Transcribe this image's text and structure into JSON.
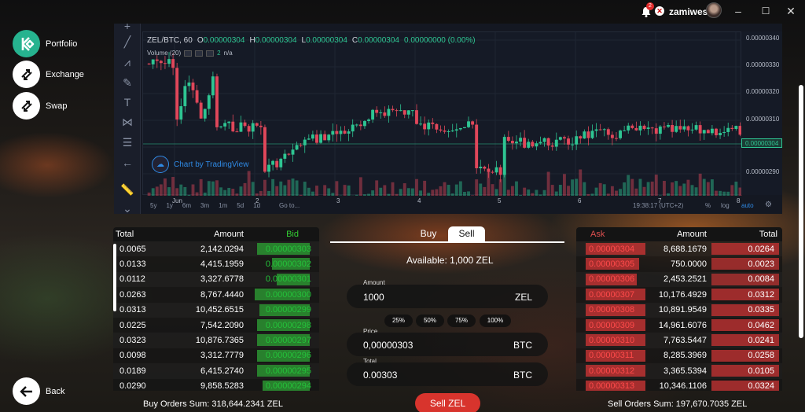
{
  "topbar": {
    "notification_count": "2",
    "username": "zamiwes",
    "minimize": "–",
    "maximize": "☐",
    "close": "✕"
  },
  "nav": {
    "portfolio": "Portfolio",
    "exchange": "Exchange",
    "swap": "Swap",
    "back": "Back"
  },
  "chart": {
    "symbol": "ZEL/BTC, 60",
    "ohlc": [
      {
        "k": "O",
        "v": "0.00000304"
      },
      {
        "k": "H",
        "v": "0.00000304"
      },
      {
        "k": "L",
        "v": "0.00000304"
      },
      {
        "k": "C",
        "v": "0.00000304"
      },
      {
        "k": "",
        "v": "0.00000000 (0.00%)"
      }
    ],
    "volume_label": "Volume (20)",
    "volume_value": "n/a",
    "volume_period": "2",
    "tradingview_label": "Chart by TradingView",
    "price_axis": [
      "0.00000340",
      "0.00000330",
      "0.00000320",
      "0.00000310",
      "0.00000300",
      "0.00000290"
    ],
    "current_price": "0.00000304",
    "time_axis": [
      "Jun",
      "2",
      "3",
      "4",
      "5",
      "6",
      "7",
      "8"
    ],
    "timeframes": [
      "5y",
      "1y",
      "6m",
      "3m",
      "1m",
      "5d",
      "1d"
    ],
    "goto": "Go to...",
    "clock": "19:38:17 (UTC+2)",
    "percent": "%",
    "log": "log",
    "auto": "auto",
    "accent_up": "#2ec592",
    "accent_down": "#e0475a"
  },
  "buy_book": {
    "headers": {
      "total": "Total",
      "amount": "Amount",
      "bid": "Bid"
    },
    "rows": [
      {
        "total": "0.0065",
        "amount": "2,142.0294",
        "bid": "0.00000303",
        "fill": 0.95
      },
      {
        "total": "0.0133",
        "amount": "4,415.1959",
        "bid": "0.00000302",
        "fill": 0.68
      },
      {
        "total": "0.0112",
        "amount": "3,327.6778",
        "bid": "0.00000301",
        "fill": 0.6
      },
      {
        "total": "0.0263",
        "amount": "8,767.4440",
        "bid": "0.00000300",
        "fill": 1.0
      },
      {
        "total": "0.0313",
        "amount": "10,452.6515",
        "bid": "0.00000299",
        "fill": 0.92
      },
      {
        "total": "0.0225",
        "amount": "7,542.2090",
        "bid": "0.00000298",
        "fill": 0.95
      },
      {
        "total": "0.0323",
        "amount": "10,876.7365",
        "bid": "0.00000297",
        "fill": 0.95
      },
      {
        "total": "0.0098",
        "amount": "3,312.7779",
        "bid": "0.00000296",
        "fill": 0.95
      },
      {
        "total": "0.0189",
        "amount": "6,415.2740",
        "bid": "0.00000295",
        "fill": 0.95
      },
      {
        "total": "0.0290",
        "amount": "9,858.5283",
        "bid": "0.00000294",
        "fill": 0.85
      }
    ],
    "sum": "Buy Orders Sum: 318,644.2341 ZEL"
  },
  "sell_book": {
    "headers": {
      "ask": "Ask",
      "amount": "Amount",
      "total": "Total"
    },
    "rows": [
      {
        "ask": "0.00000304",
        "amount": "8,688.1679",
        "total": "0.0264",
        "fill": 1.0
      },
      {
        "ask": "0.00000305",
        "amount": "750.0000",
        "total": "0.0023",
        "fill": 0.9
      },
      {
        "ask": "0.00000306",
        "amount": "2,453.2521",
        "total": "0.0084",
        "fill": 0.85
      },
      {
        "ask": "0.00000307",
        "amount": "10,176.4929",
        "total": "0.0312",
        "fill": 1.0
      },
      {
        "ask": "0.00000308",
        "amount": "10,891.9549",
        "total": "0.0335",
        "fill": 1.0
      },
      {
        "ask": "0.00000309",
        "amount": "14,961.6076",
        "total": "0.0462",
        "fill": 1.0
      },
      {
        "ask": "0.00000310",
        "amount": "7,763.5447",
        "total": "0.0241",
        "fill": 1.0
      },
      {
        "ask": "0.00000311",
        "amount": "8,285.3969",
        "total": "0.0258",
        "fill": 1.0
      },
      {
        "ask": "0.00000312",
        "amount": "3,365.5394",
        "total": "0.0105",
        "fill": 1.0
      },
      {
        "ask": "0.00000313",
        "amount": "10,346.1106",
        "total": "0.0324",
        "fill": 1.0
      }
    ],
    "sum": "Sell Orders Sum: 197,670.7035 ZEL"
  },
  "trade": {
    "tab_buy": "Buy",
    "tab_sell": "Sell",
    "available": "Available: 1,000 ZEL",
    "amount_label": "Amount",
    "amount_value": "1000",
    "amount_unit": "ZEL",
    "percents": [
      "25%",
      "50%",
      "75%",
      "100%"
    ],
    "price_label": "Price",
    "price_value": "0,00000303",
    "price_unit": "BTC",
    "total_label": "Total",
    "total_value": "0.00303",
    "total_unit": "BTC",
    "submit": "Sell ZEL"
  }
}
